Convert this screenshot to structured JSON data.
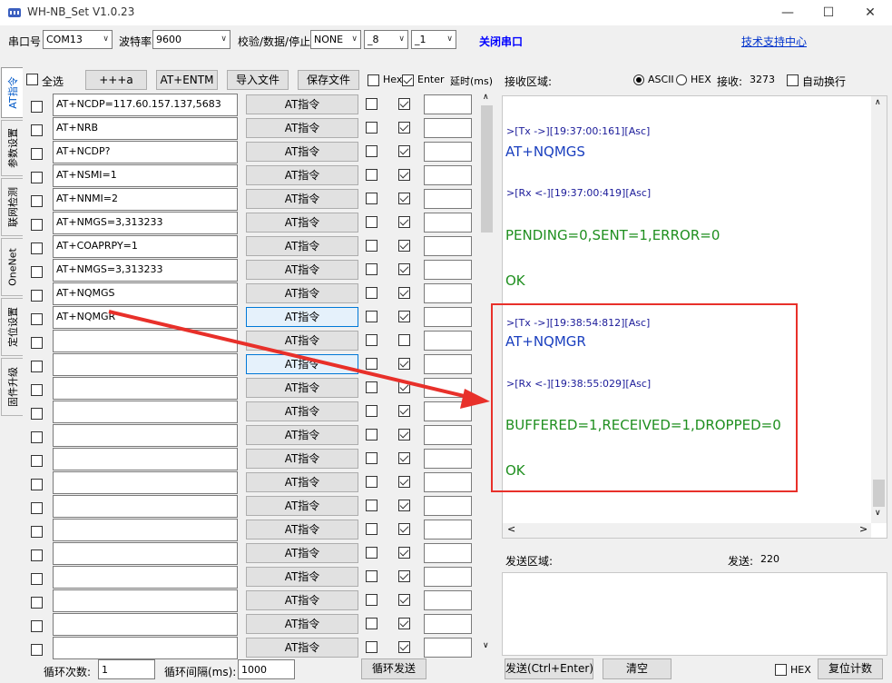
{
  "window": {
    "title": "WH-NB_Set V1.0.23",
    "minimize": "—",
    "maximize": "☐",
    "close": "✕"
  },
  "toolbar": {
    "port_label": "串口号",
    "port_value": "COM13",
    "baud_label": "波特率",
    "baud_value": "9600",
    "parity_label": "校验/数据/停止",
    "parity_value": "NONE",
    "data_value": "_8",
    "stop_value": "_1",
    "close_serial": "关闭串口",
    "support_link": "技术支持中心"
  },
  "tabs": [
    "AT指令",
    "参数设置",
    "联网检测",
    "OneNet",
    "定位设置",
    "固件升级"
  ],
  "left": {
    "select_all": "全选",
    "btn_plus": "+++a",
    "btn_entm": "AT+ENTM",
    "btn_import": "导入文件",
    "btn_save": "保存文件",
    "hex_label": "Hex",
    "enter_label": "Enter",
    "delay_label": "延时(ms)",
    "rows": [
      {
        "cmd": "AT+NCDP=117.60.157.137,5683",
        "btn": "AT指令"
      },
      {
        "cmd": "AT+NRB",
        "btn": "AT指令"
      },
      {
        "cmd": "AT+NCDP?",
        "btn": "AT指令"
      },
      {
        "cmd": "AT+NSMI=1",
        "btn": "AT指令"
      },
      {
        "cmd": "AT+NNMI=2",
        "btn": "AT指令"
      },
      {
        "cmd": "AT+NMGS=3,313233",
        "btn": "AT指令"
      },
      {
        "cmd": "AT+COAPRPY=1",
        "btn": "AT指令"
      },
      {
        "cmd": "AT+NMGS=3,313233",
        "btn": "AT指令"
      },
      {
        "cmd": "AT+NQMGS",
        "btn": "AT指令"
      },
      {
        "cmd": "AT+NQMGR",
        "btn": "AT指令"
      },
      {
        "cmd": "",
        "btn": "AT指令"
      },
      {
        "cmd": "",
        "btn": "AT指令"
      },
      {
        "cmd": "",
        "btn": "AT指令"
      },
      {
        "cmd": "",
        "btn": "AT指令"
      },
      {
        "cmd": "",
        "btn": "AT指令"
      },
      {
        "cmd": "",
        "btn": "AT指令"
      },
      {
        "cmd": "",
        "btn": "AT指令"
      },
      {
        "cmd": "",
        "btn": "AT指令"
      },
      {
        "cmd": "",
        "btn": "AT指令"
      },
      {
        "cmd": "",
        "btn": "AT指令"
      },
      {
        "cmd": "",
        "btn": "AT指令"
      },
      {
        "cmd": "",
        "btn": "AT指令"
      },
      {
        "cmd": "",
        "btn": "AT指令"
      },
      {
        "cmd": "",
        "btn": "AT指令"
      }
    ]
  },
  "receive": {
    "label": "接收区域:",
    "ascii": "ASCII",
    "hex": "HEX",
    "count_label": "接收:",
    "count": "3273",
    "auto_wrap": "自动换行",
    "log": [
      {
        "kind": "meta",
        "text": ">[Tx ->][19:37:00:161][Asc]"
      },
      {
        "kind": "tx",
        "text": "AT+NQMGS"
      },
      {
        "kind": "meta",
        "text": ">[Rx <-][19:37:00:419][Asc]"
      },
      {
        "kind": "rx",
        "text": "PENDING=0,SENT=1,ERROR=0"
      },
      {
        "kind": "rx",
        "text": "OK"
      },
      {
        "kind": "meta",
        "text": ">[Tx ->][19:38:54:812][Asc]"
      },
      {
        "kind": "tx",
        "text": "AT+NQMGR"
      },
      {
        "kind": "meta",
        "text": ">[Rx <-][19:38:55:029][Asc]"
      },
      {
        "kind": "rx",
        "text": "BUFFERED=1,RECEIVED=1,DROPPED=0"
      },
      {
        "kind": "rx",
        "text": "OK"
      }
    ]
  },
  "send": {
    "label": "发送区域:",
    "count_label": "发送:",
    "count": "220"
  },
  "bottom": {
    "loop_count_label": "循环次数:",
    "loop_count": "1",
    "loop_interval_label": "循环间隔(ms):",
    "loop_interval": "1000",
    "loop_send": "循环发送",
    "send_btn": "发送(Ctrl+Enter)",
    "clear_btn": "清空",
    "hex_label": "HEX",
    "reset_btn": "复位计数"
  },
  "colors": {
    "highlight": "#e8302a",
    "tx_text": "#1a3fbf",
    "rx_text": "#1f8f1f"
  }
}
